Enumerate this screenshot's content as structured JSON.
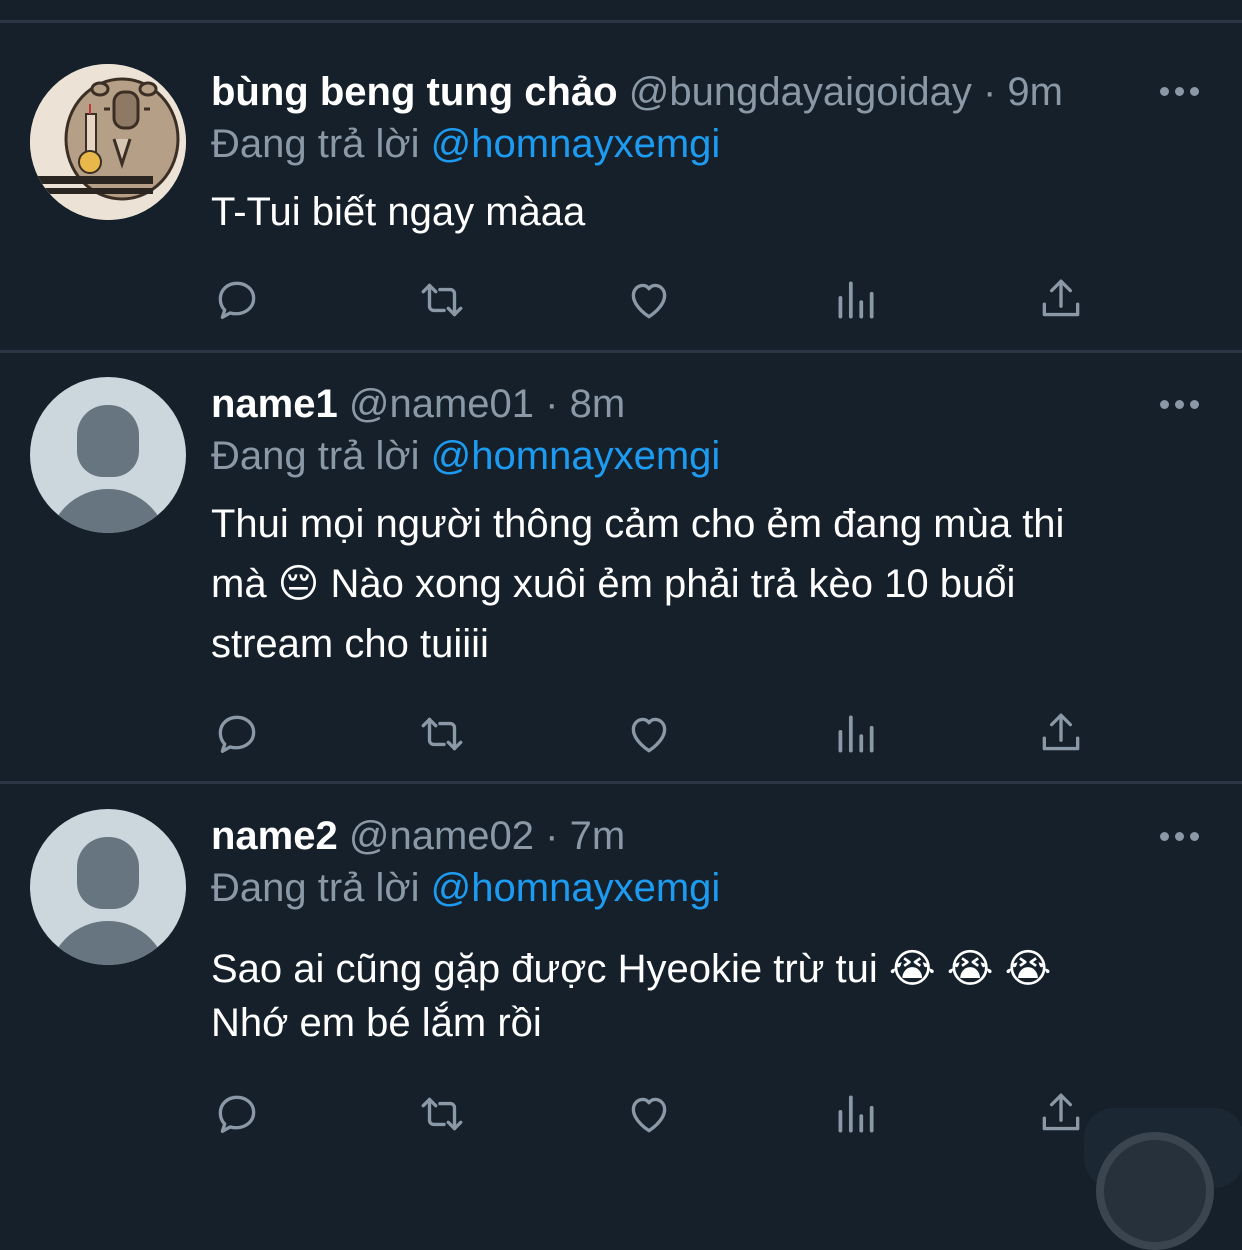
{
  "tweets": [
    {
      "display_name": "bùng beng tung chảo",
      "handle": "@bungdayaigoiday",
      "time": "· 9m",
      "reply_prefix": "Đang trả lời",
      "reply_to": "@homnayxemgi",
      "lines": [
        "T-Tui biết ngay màaa"
      ]
    },
    {
      "display_name": "name1",
      "handle": "@name01",
      "time": "· 8m",
      "reply_prefix": "Đang trả lời",
      "reply_to": "@homnayxemgi",
      "lines": [
        "Thui mọi người thông cảm cho ẻm đang mùa thi",
        "mà 😔 Nào xong xuôi ẻm phải trả kèo 10 buổi",
        "stream cho tuiiii"
      ]
    },
    {
      "display_name": "name2",
      "handle": "@name02",
      "time": "· 7m",
      "reply_prefix": "Đang trả lời",
      "reply_to": "@homnayxemgi",
      "lines": [
        "Sao ai cũng gặp được Hyeokie trừ tui 😭 😭 😭",
        "Nhớ em bé lắm rồi"
      ]
    }
  ],
  "action_icons": [
    "reply-icon",
    "retweet-icon",
    "like-icon",
    "views-icon",
    "share-icon"
  ],
  "colors": {
    "background": "#15202b",
    "divider": "#2a3643",
    "text": "#ffffff",
    "muted": "#8b98a5",
    "mention": "#1d9bf0"
  }
}
